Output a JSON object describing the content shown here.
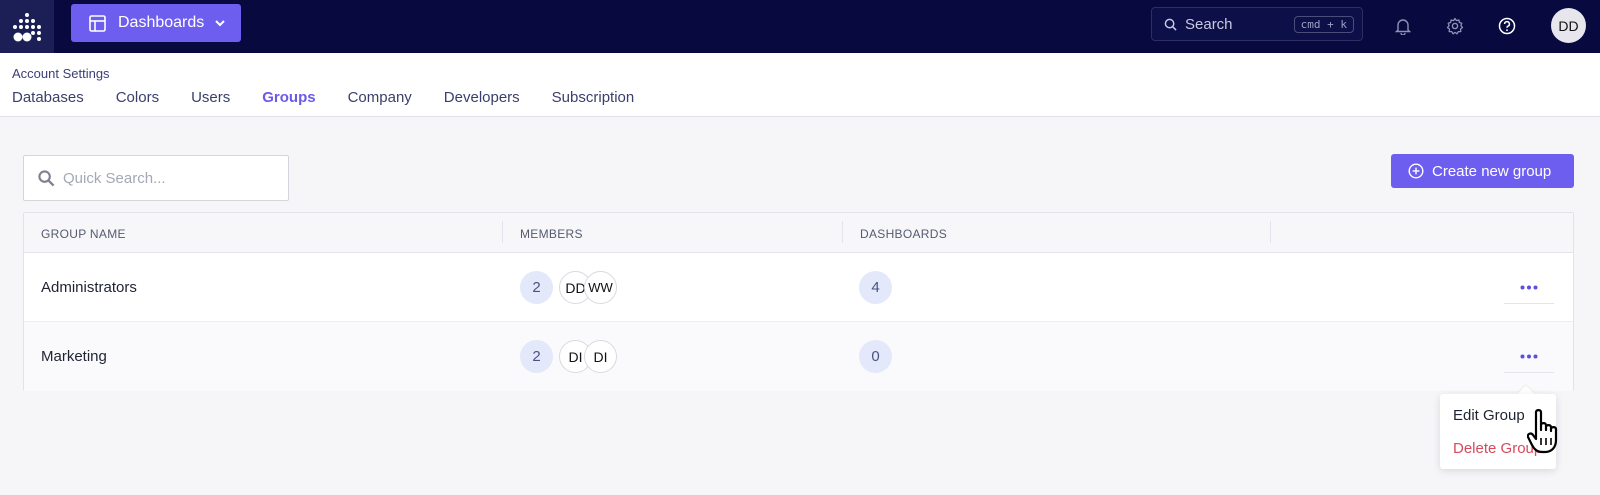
{
  "topbar": {
    "app_button_label": "Dashboards",
    "search": {
      "label": "Search",
      "shortcut": "cmd + k"
    },
    "avatar_initials": "DD",
    "icons": [
      "logo-icon",
      "dashboard-grid-icon",
      "chevron-down-icon",
      "search-icon",
      "bell-icon",
      "gear-icon",
      "help-icon"
    ]
  },
  "subnav": {
    "breadcrumb": "Account Settings",
    "tabs": [
      {
        "label": "Databases",
        "active": false
      },
      {
        "label": "Colors",
        "active": false
      },
      {
        "label": "Users",
        "active": false
      },
      {
        "label": "Groups",
        "active": true
      },
      {
        "label": "Company",
        "active": false
      },
      {
        "label": "Developers",
        "active": false
      },
      {
        "label": "Subscription",
        "active": false
      }
    ]
  },
  "content": {
    "quick_search_placeholder": "Quick Search...",
    "create_button_label": "Create new group",
    "table": {
      "headers": [
        "GROUP NAME",
        "MEMBERS",
        "DASHBOARDS"
      ],
      "rows": [
        {
          "name": "Administrators",
          "member_count": "2",
          "members": [
            "DD",
            "WW"
          ],
          "dashboards": "4"
        },
        {
          "name": "Marketing",
          "member_count": "2",
          "members": [
            "DI",
            "DI"
          ],
          "dashboards": "0"
        }
      ]
    },
    "menu": {
      "edit_label": "Edit Group",
      "delete_label": "Delete Group"
    }
  },
  "colors": {
    "topbar_bg": "#07093f",
    "accent": "#6d5ef0",
    "active_tab": "#6b5ae8",
    "danger": "#d84a5d"
  }
}
